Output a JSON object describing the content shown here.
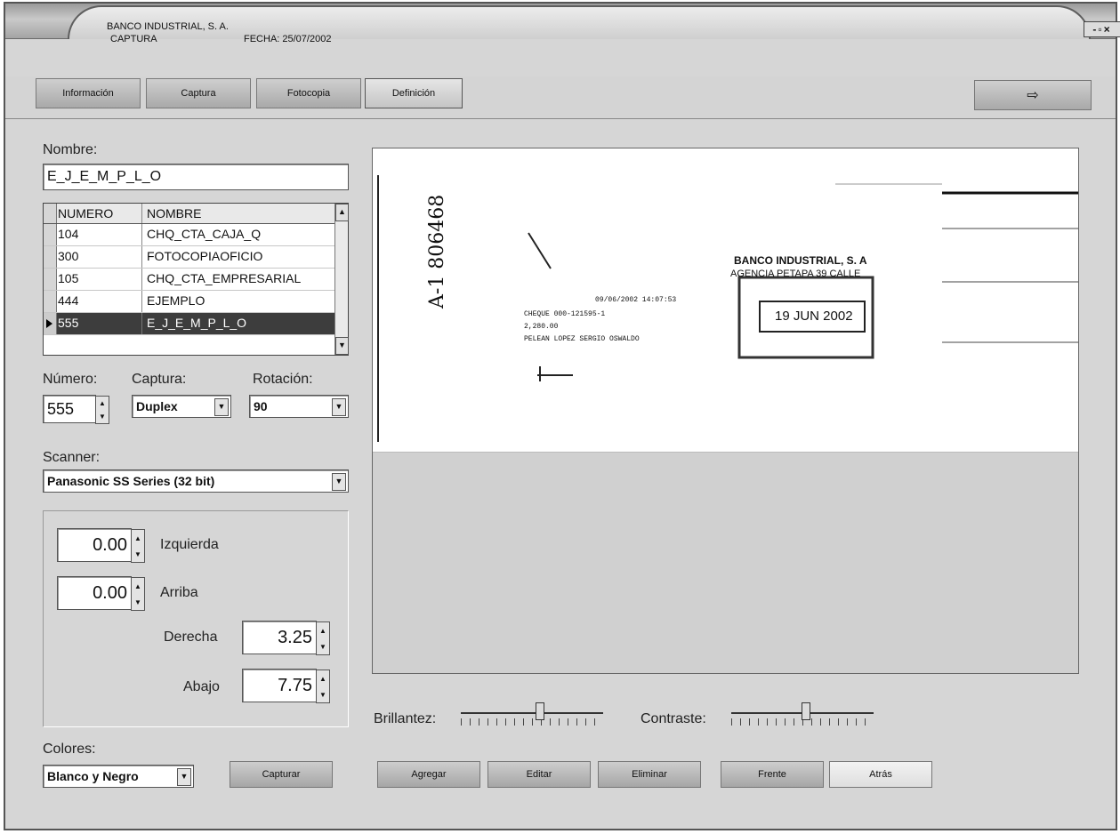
{
  "titlebar": {
    "bank": "BANCO INDUSTRIAL, S. A.",
    "screen": "CAPTURA",
    "date": "FECHA: 25/07/2002",
    "controls": "-▫×"
  },
  "tabs": [
    {
      "label": "Información"
    },
    {
      "label": "Captura"
    },
    {
      "label": "Fotocopia"
    },
    {
      "label": "Definición"
    }
  ],
  "exit_icon": "⇨",
  "nombre": {
    "label": "Nombre:",
    "value": "E_J_E_M_P_L_O"
  },
  "table": {
    "headers": [
      "NUMERO",
      "NOMBRE"
    ],
    "rows": [
      {
        "numero": "104",
        "nombre": "CHQ_CTA_CAJA_Q"
      },
      {
        "numero": "300",
        "nombre": "FOTOCOPIAOFICIO"
      },
      {
        "numero": "105",
        "nombre": "CHQ_CTA_EMPRESARIAL"
      },
      {
        "numero": "444",
        "nombre": "EJEMPLO"
      },
      {
        "numero": "555",
        "nombre": "E_J_E_M_P_L_O"
      }
    ],
    "selected_index": 4
  },
  "numero": {
    "label": "Número:",
    "value": "555"
  },
  "captura": {
    "label": "Captura:",
    "value": "Duplex"
  },
  "rotacion": {
    "label": "Rotación:",
    "value": "90"
  },
  "scanner": {
    "label": "Scanner:",
    "value": "Panasonic SS Series (32 bit)"
  },
  "margins": {
    "izquierda": {
      "label": "Izquierda",
      "value": "0.00"
    },
    "arriba": {
      "label": "Arriba",
      "value": "0.00"
    },
    "derecha": {
      "label": "Derecha",
      "value": "3.25"
    },
    "abajo": {
      "label": "Abajo",
      "value": "7.75"
    }
  },
  "colores": {
    "label": "Colores:",
    "value": "Blanco y Negro"
  },
  "capturar_label": "Capturar",
  "preview": {
    "stamp_bank": "BANCO INDUSTRIAL, S. A",
    "stamp_agency": "AGENCIA PETAPA 39 CALLE",
    "stamp_date": "19 JUN 2002",
    "line1": "09/06/2002 14:07:53",
    "line2": "CHEQUE 000-121595-1",
    "line3": "2,280.00",
    "line4": "PELEAN LOPEZ SERGIO OSWALDO",
    "handwriting": "A-1 806468"
  },
  "brillantez": {
    "label": "Brillantez:",
    "level": 0.55
  },
  "contraste": {
    "label": "Contraste:",
    "level": 0.52
  },
  "actions": [
    {
      "label": "Agregar"
    },
    {
      "label": "Editar"
    },
    {
      "label": "Eliminar"
    },
    {
      "label": "Frente"
    },
    {
      "label": "Atrás"
    }
  ]
}
